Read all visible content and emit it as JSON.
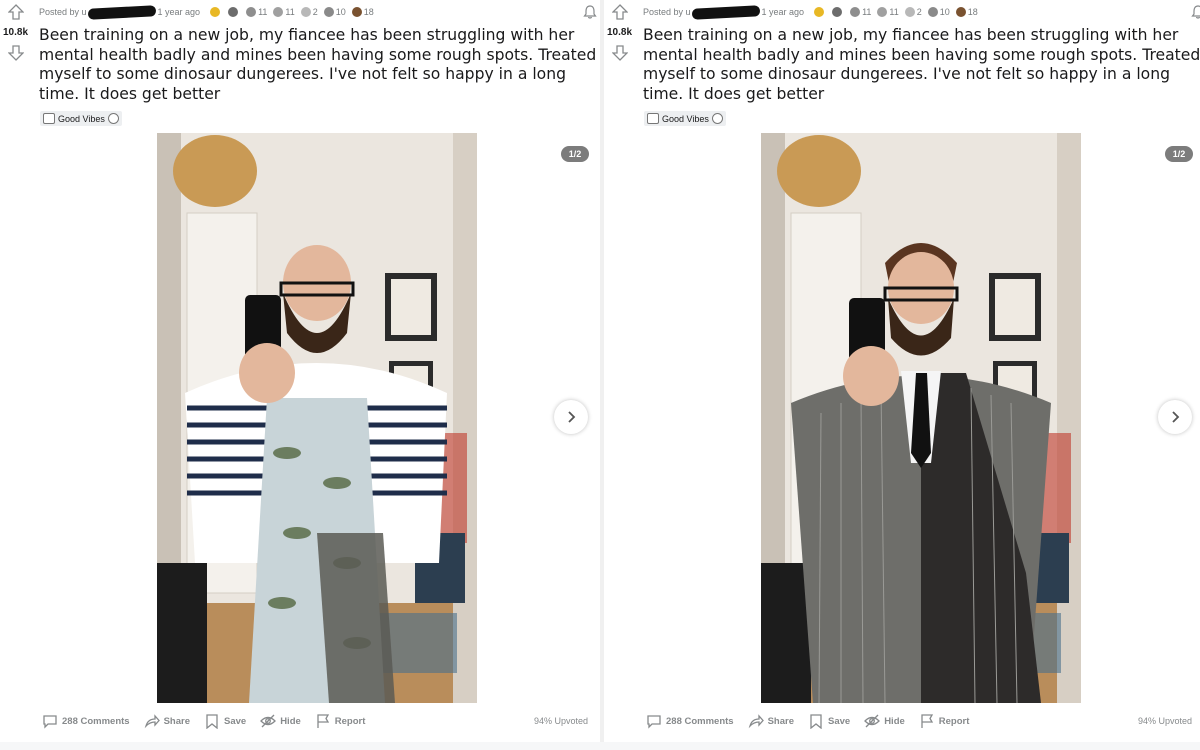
{
  "posts": [
    {
      "score": "10.8k",
      "posted_by_prefix": "Posted by u",
      "time_ago": "1 year ago",
      "award_counts": [
        "11",
        "11",
        "2",
        "10",
        "18"
      ],
      "title": "Been training on a new job, my fiancee has been struggling with her mental health badly and mines been having some rough spots. Treated myself to some dinosaur dungerees. I've not felt so happy in a long time. It does get better",
      "flair": "Good Vibes",
      "gallery_counter": "1/2",
      "actions": {
        "comments": "288 Comments",
        "share": "Share",
        "save": "Save",
        "hide": "Hide",
        "report": "Report"
      },
      "upvoted": "94% Upvoted"
    },
    {
      "score": "10.8k",
      "posted_by_prefix": "Posted by u",
      "time_ago": "1 year ago",
      "award_counts": [
        "11",
        "11",
        "2",
        "10",
        "18"
      ],
      "title": "Been training on a new job, my fiancee has been struggling with her mental health badly and mines been having some rough spots. Treated myself to some dinosaur dungerees. I've not felt so happy in a long time. It does get better",
      "flair": "Good Vibes",
      "gallery_counter": "1/2",
      "actions": {
        "comments": "288 Comments",
        "share": "Share",
        "save": "Save",
        "hide": "Hide",
        "report": "Report"
      },
      "upvoted": "94% Upvoted"
    }
  ],
  "colors": {
    "text_primary": "#1a1a1b",
    "text_meta": "#787c7e",
    "action_gray": "#878a8c",
    "counter_bg": "#7c7c7c",
    "flair_bg": "#edeff1"
  },
  "icons": [
    "upvote-icon",
    "downvote-icon",
    "bell-icon",
    "comment-icon",
    "share-icon",
    "save-icon",
    "hide-icon",
    "report-icon",
    "chevron-right-icon"
  ]
}
